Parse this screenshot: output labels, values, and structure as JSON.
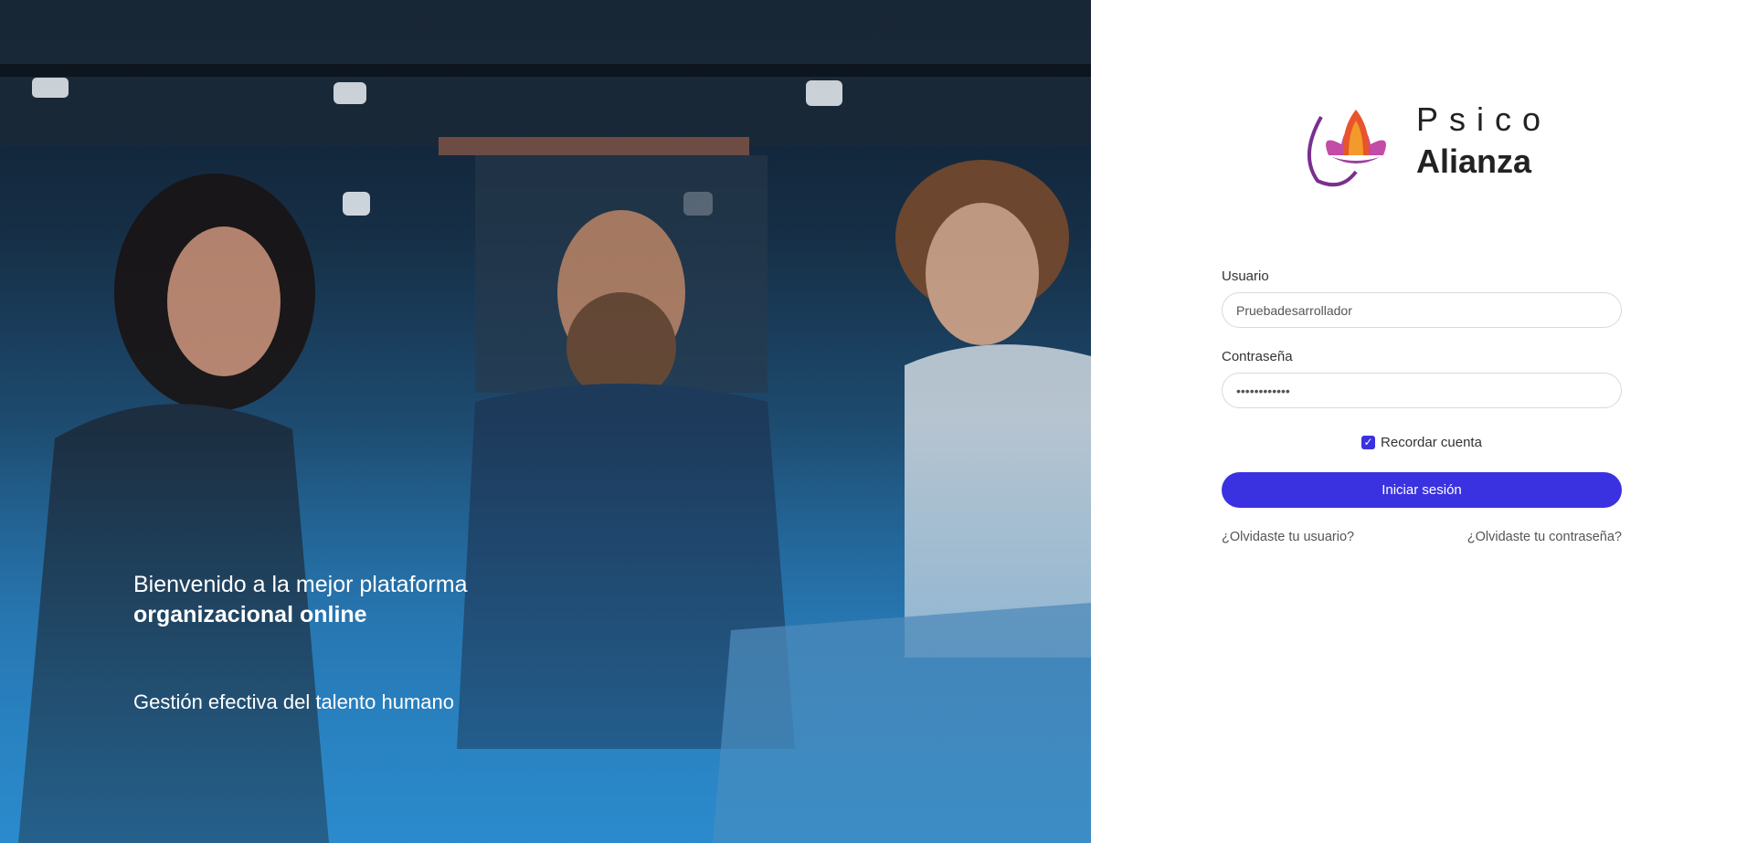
{
  "hero": {
    "title_line1": "Bienvenido a la mejor plataforma",
    "title_line2": "organizacional online",
    "subtitle": "Gestión efectiva del talento humano"
  },
  "logo": {
    "word1": "Psico",
    "word2": "Alianza"
  },
  "form": {
    "username_label": "Usuario",
    "username_value": "Pruebadesarrollador",
    "password_label": "Contraseña",
    "password_value": "************",
    "remember_label": "Recordar cuenta",
    "remember_checked": true,
    "submit_label": "Iniciar sesión",
    "forgot_user": "¿Olvidaste tu usuario?",
    "forgot_password": "¿Olvidaste tu contraseña?"
  },
  "colors": {
    "primary": "#3a32e0",
    "hero_blue": "#2b89cb"
  }
}
